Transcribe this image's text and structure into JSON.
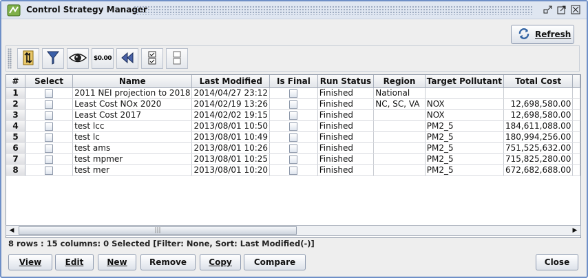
{
  "window": {
    "title": "Control Strategy Manager",
    "minimize_glyph": "▫↗",
    "maximize_glyph": "⤢",
    "close_glyph": "☒"
  },
  "toolbar": {
    "refresh_label": "Refresh",
    "refresh_icon": "refresh-icon",
    "buttons": [
      {
        "name": "sort-icon",
        "label": ""
      },
      {
        "name": "filter-icon",
        "label": ""
      },
      {
        "name": "eye-icon",
        "label": ""
      },
      {
        "name": "money-icon",
        "label": "$0.00"
      },
      {
        "name": "rewind-icon",
        "label": ""
      },
      {
        "name": "select-all-icon",
        "label": ""
      },
      {
        "name": "clear-selection-icon",
        "label": ""
      }
    ]
  },
  "table": {
    "columns": [
      "#",
      "Select",
      "Name",
      "Last Modified",
      "Is Final",
      "Run Status",
      "Region",
      "Target Pollutant",
      "Total Cost"
    ],
    "rows": [
      {
        "num": "1",
        "name": "2011 NEI projection to 2018",
        "modified": "2014/04/27 23:12",
        "status": "Finished",
        "region": "National",
        "pollutant": "",
        "cost": ""
      },
      {
        "num": "2",
        "name": "Least Cost NOx 2020",
        "modified": "2014/02/19 13:26",
        "status": "Finished",
        "region": "NC, SC, VA",
        "pollutant": "NOX",
        "cost": "12,698,580.00"
      },
      {
        "num": "3",
        "name": "Least Cost 2017",
        "modified": "2014/02/02 19:15",
        "status": "Finished",
        "region": "",
        "pollutant": "NOX",
        "cost": "12,698,580.00"
      },
      {
        "num": "4",
        "name": "test lcc",
        "modified": "2013/08/01 10:50",
        "status": "Finished",
        "region": "",
        "pollutant": "PM2_5",
        "cost": "184,611,088.00"
      },
      {
        "num": "5",
        "name": "test lc",
        "modified": "2013/08/01 10:49",
        "status": "Finished",
        "region": "",
        "pollutant": "PM2_5",
        "cost": "180,994,256.00"
      },
      {
        "num": "6",
        "name": "test ams",
        "modified": "2013/08/01 10:26",
        "status": "Finished",
        "region": "",
        "pollutant": "PM2_5",
        "cost": "751,525,632.00"
      },
      {
        "num": "7",
        "name": "test mpmer",
        "modified": "2013/08/01 10:25",
        "status": "Finished",
        "region": "",
        "pollutant": "PM2_5",
        "cost": "715,825,280.00"
      },
      {
        "num": "8",
        "name": "test mer",
        "modified": "2013/08/01 10:20",
        "status": "Finished",
        "region": "",
        "pollutant": "PM2_5",
        "cost": "672,682,688.00"
      }
    ]
  },
  "scroll": {
    "left_arrow": "◀",
    "right_arrow": "▶",
    "thumb_grip": "|||"
  },
  "status_text": "8 rows : 15 columns: 0 Selected [Filter: None, Sort: Last Modified(-)]",
  "buttons": {
    "view": "View",
    "edit": "Edit",
    "new": "New",
    "remove": "Remove",
    "copy": "Copy",
    "compare": "Compare",
    "close": "Close"
  },
  "colors": {
    "window_border": "#6e8fc7",
    "titlebar": "#dfe6f1",
    "background": "#eeeeee"
  }
}
